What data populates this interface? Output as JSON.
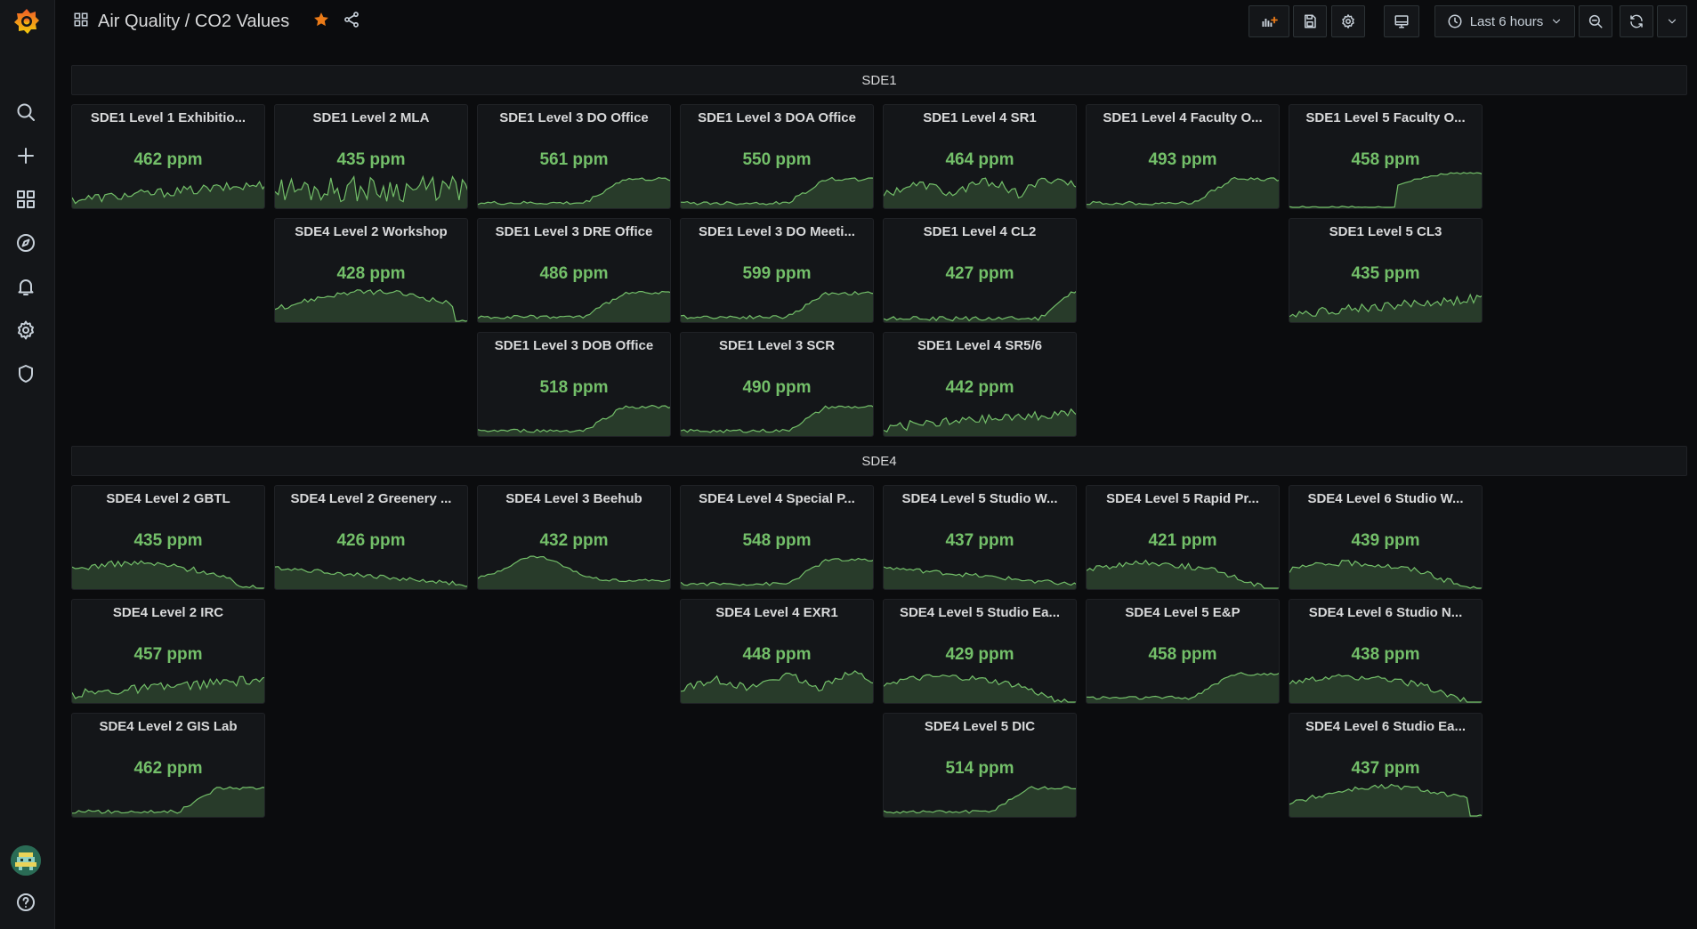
{
  "topbar": {
    "title": "Air Quality / CO2 Values",
    "time_range": "Last 6 hours"
  },
  "colors": {
    "accent": "#73bf69",
    "star": "#eb7b18",
    "bg": "#0b0c0e",
    "panel": "#141619"
  },
  "sidebar": {
    "items": [
      {
        "icon": "search-icon"
      },
      {
        "icon": "plus-icon"
      },
      {
        "icon": "dashboards-icon"
      },
      {
        "icon": "explore-icon"
      },
      {
        "icon": "alerting-icon"
      },
      {
        "icon": "gear-icon"
      },
      {
        "icon": "shield-icon"
      },
      {
        "icon": "help-icon"
      }
    ]
  },
  "rows": [
    {
      "title": "SDE1",
      "panels": [
        {
          "title": "SDE1 Level 1 Exhibitio...",
          "value": "462 ppm",
          "col": 0,
          "row": 0,
          "spark": "noise_rise"
        },
        {
          "title": "SDE1 Level 2 MLA",
          "value": "435 ppm",
          "col": 1,
          "row": 0,
          "spark": "noisy"
        },
        {
          "title": "SDE1 Level 3 DO Office",
          "value": "561 ppm",
          "col": 2,
          "row": 0,
          "spark": "step_up"
        },
        {
          "title": "SDE1 Level 3 DOA Office",
          "value": "550 ppm",
          "col": 3,
          "row": 0,
          "spark": "step_up"
        },
        {
          "title": "SDE1 Level 4 SR1",
          "value": "464 ppm",
          "col": 4,
          "row": 0,
          "spark": "bumpy"
        },
        {
          "title": "SDE1 Level 4 Faculty O...",
          "value": "493 ppm",
          "col": 5,
          "row": 0,
          "spark": "step_up"
        },
        {
          "title": "SDE1 Level 5 Faculty O...",
          "value": "458 ppm",
          "col": 6,
          "row": 0,
          "spark": "late_step"
        },
        {
          "title": "SDE4 Level 2 Workshop",
          "value": "428 ppm",
          "col": 1,
          "row": 1,
          "spark": "hump_drop"
        },
        {
          "title": "SDE1 Level 3 DRE Office",
          "value": "486 ppm",
          "col": 2,
          "row": 1,
          "spark": "step_up"
        },
        {
          "title": "SDE1 Level 3 DO Meeti...",
          "value": "599 ppm",
          "col": 3,
          "row": 1,
          "spark": "step_up"
        },
        {
          "title": "SDE1 Level 4 CL2",
          "value": "427 ppm",
          "col": 4,
          "row": 1,
          "spark": "end_rise"
        },
        {
          "title": "SDE1 Level 5 CL3",
          "value": "435 ppm",
          "col": 6,
          "row": 1,
          "spark": "noise_rise"
        },
        {
          "title": "SDE1 Level 3 DOB Office",
          "value": "518 ppm",
          "col": 2,
          "row": 2,
          "spark": "step_up"
        },
        {
          "title": "SDE1 Level 3 SCR",
          "value": "490 ppm",
          "col": 3,
          "row": 2,
          "spark": "step_up"
        },
        {
          "title": "SDE1 Level 4 SR5/6",
          "value": "442 ppm",
          "col": 4,
          "row": 2,
          "spark": "noise_rise"
        }
      ]
    },
    {
      "title": "SDE4",
      "panels": [
        {
          "title": "SDE4 Level 2 GBTL",
          "value": "435 ppm",
          "col": 0,
          "row": 0,
          "spark": "plateau_drop"
        },
        {
          "title": "SDE4 Level 2 Greenery ...",
          "value": "426 ppm",
          "col": 1,
          "row": 0,
          "spark": "declining"
        },
        {
          "title": "SDE4 Level 3 Beehub",
          "value": "432 ppm",
          "col": 2,
          "row": 0,
          "spark": "hump"
        },
        {
          "title": "SDE4 Level 4 Special P...",
          "value": "548 ppm",
          "col": 3,
          "row": 0,
          "spark": "step_up"
        },
        {
          "title": "SDE4 Level 5 Studio W...",
          "value": "437 ppm",
          "col": 4,
          "row": 0,
          "spark": "declining"
        },
        {
          "title": "SDE4 Level 5 Rapid Pr...",
          "value": "421 ppm",
          "col": 5,
          "row": 0,
          "spark": "plateau_drop"
        },
        {
          "title": "SDE4 Level 6 Studio W...",
          "value": "439 ppm",
          "col": 6,
          "row": 0,
          "spark": "plateau_drop"
        },
        {
          "title": "SDE4 Level 2 IRC",
          "value": "457 ppm",
          "col": 0,
          "row": 1,
          "spark": "noise_rise"
        },
        {
          "title": "SDE4 Level 4 EXR1",
          "value": "448 ppm",
          "col": 3,
          "row": 1,
          "spark": "bumpy"
        },
        {
          "title": "SDE4 Level 5 Studio Ea...",
          "value": "429 ppm",
          "col": 4,
          "row": 1,
          "spark": "plateau_drop"
        },
        {
          "title": "SDE4 Level 5 E&P",
          "value": "458 ppm",
          "col": 5,
          "row": 1,
          "spark": "step_up"
        },
        {
          "title": "SDE4 Level 6 Studio N...",
          "value": "438 ppm",
          "col": 6,
          "row": 1,
          "spark": "plateau_drop"
        },
        {
          "title": "SDE4 Level 2 GIS Lab",
          "value": "462 ppm",
          "col": 0,
          "row": 2,
          "spark": "step_up"
        },
        {
          "title": "SDE4 Level 5 DIC",
          "value": "514 ppm",
          "col": 4,
          "row": 2,
          "spark": "step_up"
        },
        {
          "title": "SDE4 Level 6 Studio Ea...",
          "value": "437 ppm",
          "col": 6,
          "row": 2,
          "spark": "hump_drop"
        }
      ]
    }
  ]
}
